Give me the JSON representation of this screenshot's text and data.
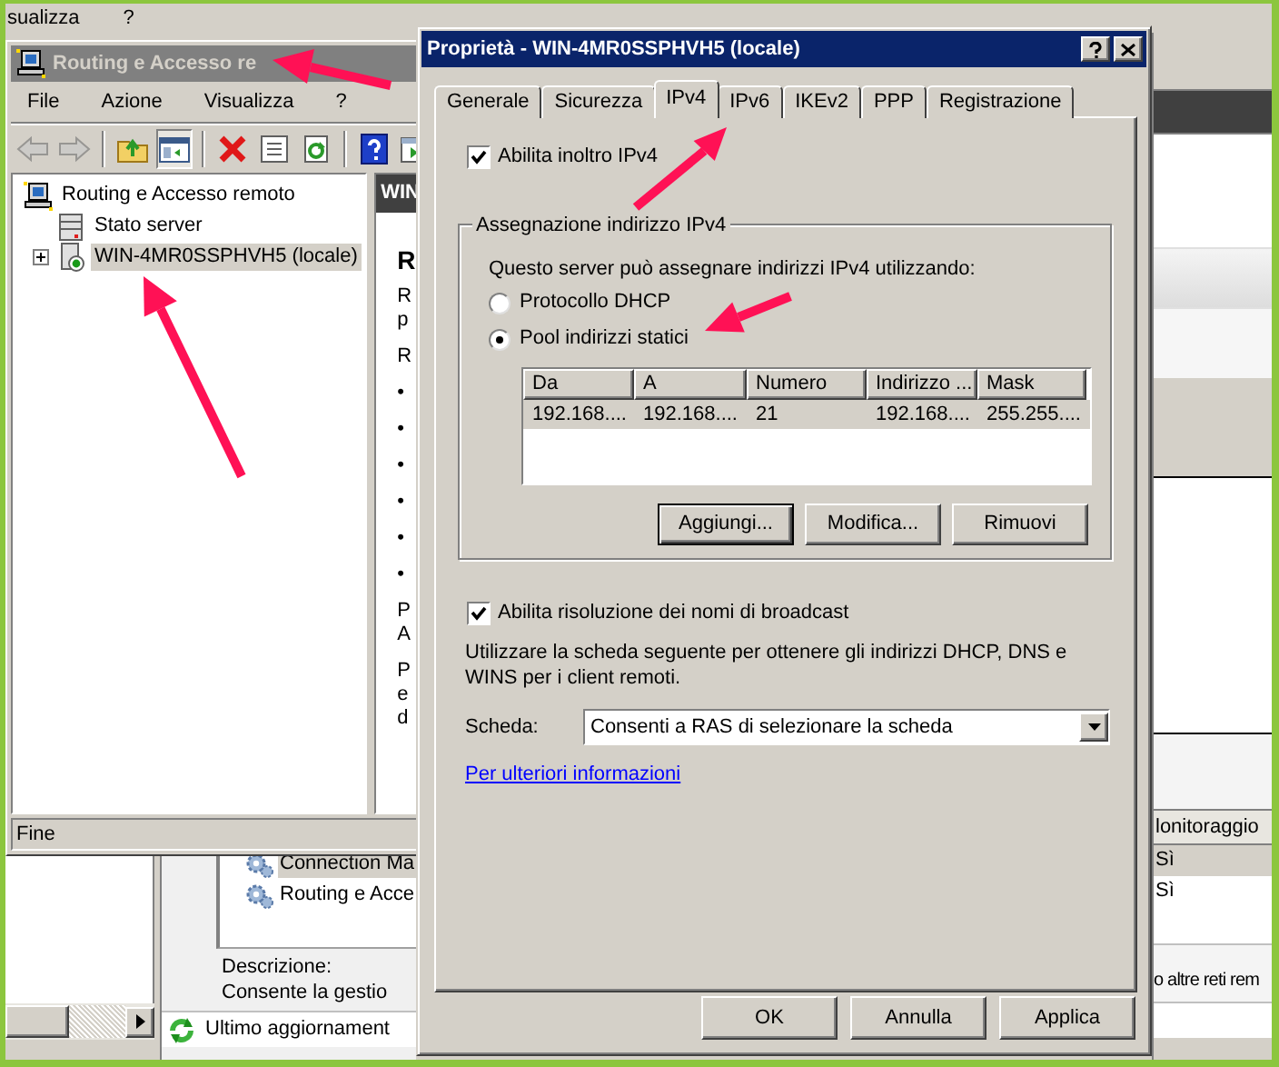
{
  "desktop_menu": [
    "sualizza",
    "?"
  ],
  "services_list": {
    "rows": [
      {
        "name": "Connection Ma",
        "selected": true
      },
      {
        "name": "Routing e Acce",
        "selected": false
      }
    ],
    "description_label": "Descrizione:",
    "description": "Consente la gestio",
    "status": "Ultimo aggiornament"
  },
  "right_panel": {
    "column_header": "lonitoraggio",
    "rows": [
      {
        "value": "Sì",
        "selected": true
      },
      {
        "value": "Sì",
        "selected": false
      }
    ],
    "description": "o altre reti rem"
  },
  "mmc": {
    "title": "Routing e Accesso re",
    "menu": [
      "File",
      "Azione",
      "Visualizza",
      "?"
    ],
    "toolbar": [
      {
        "kind": "back",
        "disabled": true,
        "pressed": false
      },
      {
        "kind": "forward",
        "disabled": true,
        "pressed": false
      },
      {
        "kind": "up",
        "disabled": false,
        "pressed": false
      },
      {
        "kind": "tree",
        "disabled": false,
        "pressed": true
      },
      {
        "kind": "delete",
        "disabled": false,
        "pressed": false
      },
      {
        "kind": "properties",
        "disabled": false,
        "pressed": false
      },
      {
        "kind": "refresh",
        "disabled": false,
        "pressed": false
      },
      {
        "kind": "help",
        "disabled": false,
        "pressed": false
      },
      {
        "kind": "action",
        "disabled": false,
        "pressed": false
      }
    ],
    "tree": [
      {
        "label": "Routing e Accesso remoto",
        "kind": "root",
        "selected": false,
        "children": [
          {
            "label": "Stato server",
            "kind": "status",
            "selected": false
          },
          {
            "label": "WIN-4MR0SSPHVH5 (locale)",
            "kind": "server",
            "selected": true,
            "expanded": false
          }
        ]
      }
    ],
    "details_header": "WIN",
    "details_heading": "R",
    "details_paragraphs": [
      [
        "R",
        "p"
      ],
      [
        "R"
      ],
      [
        "•"
      ],
      [
        "•"
      ],
      [
        "•"
      ],
      [
        "•"
      ],
      [
        "•"
      ],
      [
        "•"
      ],
      [
        "P",
        "A"
      ],
      [
        "P",
        "e",
        "d"
      ]
    ],
    "status": "Fine"
  },
  "dialog": {
    "title": "Proprietà - WIN-4MR0SSPHVH5 (locale)",
    "tabs": [
      {
        "label": "Generale",
        "selected": false
      },
      {
        "label": "Sicurezza",
        "selected": false
      },
      {
        "label": "IPv4",
        "selected": true
      },
      {
        "label": "IPv6",
        "selected": false
      },
      {
        "label": "IKEv2",
        "selected": false
      },
      {
        "label": "PPP",
        "selected": false
      },
      {
        "label": "Registrazione",
        "selected": false
      }
    ],
    "forwarding": {
      "label": "Abilita inoltro IPv4",
      "checked": true
    },
    "group_title": "Assegnazione indirizzo IPv4",
    "group_text": "Questo server può assegnare indirizzi IPv4 utilizzando:",
    "options": [
      {
        "label": "Protocollo DHCP",
        "selected": false
      },
      {
        "label": "Pool indirizzi statici",
        "selected": true
      }
    ],
    "pool_table": {
      "columns": [
        "Da",
        "A",
        "Numero",
        "Indirizzo ...",
        "Mask"
      ],
      "rows": [
        {
          "cells": [
            "192.168....",
            "192.168....",
            "21",
            "192.168....",
            "255.255...."
          ],
          "selected": true
        }
      ]
    },
    "pool_buttons": [
      {
        "label": "Aggiungi...",
        "focused": true
      },
      {
        "label": "Modifica...",
        "focused": false
      },
      {
        "label": "Rimuovi",
        "focused": false
      }
    ],
    "broadcast": {
      "label": "Abilita risoluzione dei nomi di broadcast",
      "checked": true
    },
    "adapter_text": "Utilizzare la scheda seguente per ottenere gli indirizzi DHCP, DNS e WINS per i client remoti.",
    "adapter_label": "Scheda:",
    "adapter_value": "Consenti a RAS di selezionare la scheda",
    "link": "Per ulteriori informazioni",
    "buttons": [
      "OK",
      "Annulla",
      "Applica"
    ]
  }
}
